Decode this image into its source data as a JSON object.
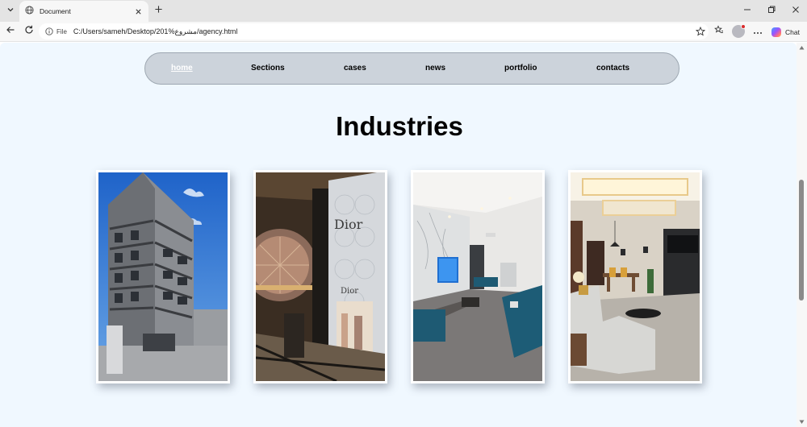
{
  "browser": {
    "tab_title": "Document",
    "address_scheme": "File",
    "address_url": "C:/Users/sameh/Desktop/201%مشروع/agency.html",
    "chat_label": "Chat"
  },
  "nav": {
    "items": [
      {
        "label": "home",
        "active": true
      },
      {
        "label": "Sections",
        "active": false
      },
      {
        "label": "cases",
        "active": false
      },
      {
        "label": "news",
        "active": false
      },
      {
        "label": "portfolio",
        "active": false
      },
      {
        "label": "contacts",
        "active": false
      }
    ]
  },
  "section": {
    "heading": "Industries"
  },
  "gallery": {
    "items": [
      {
        "name": "building-photo"
      },
      {
        "name": "mall-store-photo"
      },
      {
        "name": "living-room-photo"
      },
      {
        "name": "apartment-interior-photo"
      }
    ]
  },
  "colors": {
    "page_bg": "#f0f8ff",
    "navbar_bg": "#ccd3db",
    "active_link": "#ffffff"
  },
  "icons": {
    "tab_list": "chevron-down-icon",
    "tab_favicon": "globe-icon",
    "tab_close": "close-icon",
    "new_tab": "plus-icon",
    "back": "back-arrow-icon",
    "reload": "reload-icon",
    "site_info": "info-icon",
    "favorite": "star-icon",
    "collections": "favorites-icon",
    "profile": "avatar-icon",
    "more": "more-icon"
  }
}
